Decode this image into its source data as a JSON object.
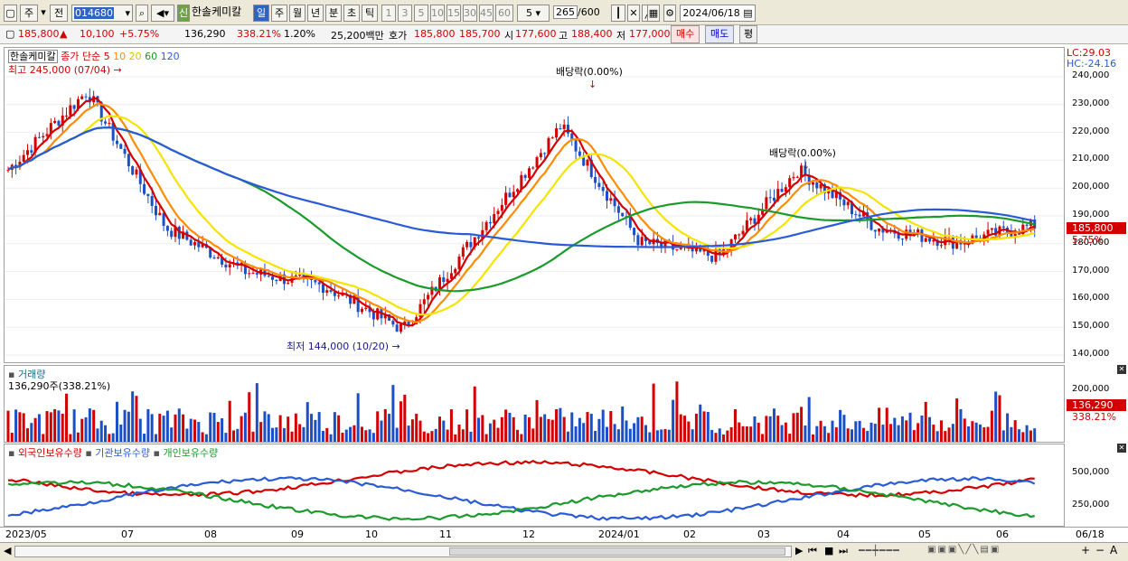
{
  "toolbar": {
    "period_main": "주",
    "period_prev": "전",
    "code": "014680",
    "name": "한솔케미칼",
    "new_badge": "신",
    "periods": [
      "일",
      "주",
      "월",
      "년",
      "분",
      "초",
      "틱"
    ],
    "intervals": [
      "1",
      "3",
      "5",
      "10",
      "15",
      "30",
      "45",
      "60"
    ],
    "count_sel": "5",
    "count_value": "265",
    "count_total": "/600",
    "date": "2024/06/18"
  },
  "status": {
    "price": "185,800",
    "arrow": "▲",
    "change": "10,100",
    "change_pct": "+5.75%",
    "volume": "136,290",
    "vol_pct": "338.21%",
    "turnover": "1.20%",
    "amount": "25,200백만",
    "bid_label": "호가",
    "bid1": "185,800",
    "bid2": "185,700",
    "open_label": "시",
    "open": "177,600",
    "high_label": "고",
    "high": "188,400",
    "low_label": "저",
    "low": "177,000",
    "buy": "매수",
    "sell": "매도",
    "avg": "평"
  },
  "price_pane": {
    "legend_name": "한솔케미칼",
    "legend_type": "종가 단순",
    "ma": [
      "5",
      "10",
      "20",
      "60",
      "120"
    ],
    "hi_label": "최고 245,000 (07/04)",
    "lo_label": "최저 144,000 (10/20)",
    "div1": "배당락(0.00%)",
    "div2": "배당락(0.00%)",
    "lc": "LC:29.03",
    "hc": "HC:-24.16",
    "cur_price": "185,800",
    "cur_pct": "5.75%",
    "yticks": [
      "240,000",
      "230,000",
      "220,000",
      "210,000",
      "200,000",
      "190,000",
      "180,000",
      "170,000",
      "160,000",
      "150,000",
      "140,000"
    ]
  },
  "volume_pane": {
    "title": "거래량",
    "value": "136,290주(338.21%)",
    "ytick": "200,000",
    "ytick2": "100,000",
    "cur": "136,290",
    "cur_pct": "338.21%"
  },
  "holder_pane": {
    "legend": [
      "외국인보유수량",
      "기관보유수량",
      "개인보유수량"
    ],
    "yticks": [
      "500,000",
      "250,000"
    ]
  },
  "xaxis": [
    "2023/05",
    "07",
    "08",
    "09",
    "10",
    "11",
    "12",
    "2024/01",
    "02",
    "03",
    "04",
    "05",
    "06",
    "06/18"
  ],
  "colors": {
    "up": "#d40000",
    "down": "#1a4fc8",
    "ma5": "#d40000",
    "ma10": "#ff8c00",
    "ma20": "#f5e400",
    "ma60": "#1a9a2a",
    "ma120": "#2a5bd7"
  },
  "chart_data": {
    "type": "line",
    "title": "한솔케미칼",
    "x": [
      "2023/05",
      "07",
      "08",
      "09",
      "10",
      "11",
      "12",
      "2024/01",
      "02",
      "03",
      "04",
      "05",
      "06",
      "06/18"
    ],
    "series": [
      {
        "name": "종가",
        "values": [
          205000,
          232000,
          185000,
          170000,
          165000,
          150000,
          185000,
          220000,
          180000,
          175000,
          205000,
          185000,
          180000,
          185800
        ]
      }
    ],
    "ylim": [
      140000,
      245000
    ]
  }
}
